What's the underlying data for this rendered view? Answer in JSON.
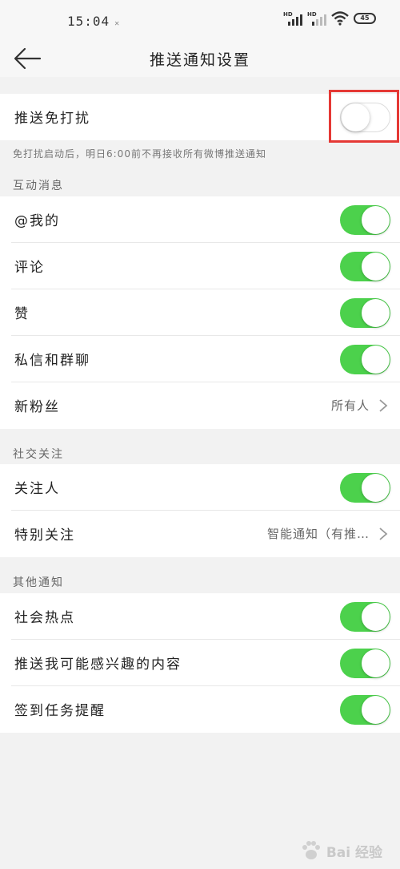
{
  "status_bar": {
    "time": "15:04",
    "mute_mark": "✕",
    "sim1_label": "HD",
    "sim2_label": "HD",
    "battery": "45",
    "icons": [
      "signal-icon",
      "signal-icon",
      "wifi-icon",
      "battery-icon"
    ]
  },
  "header": {
    "title": "推送通知设置",
    "back_icon": "back-arrow-icon"
  },
  "dnd": {
    "label": "推送免打扰",
    "enabled": false,
    "hint": "免打扰启动后，明日6:00前不再接收所有微博推送通知"
  },
  "sections": [
    {
      "title": "互动消息",
      "items": [
        {
          "label": "@我的",
          "type": "toggle",
          "enabled": true
        },
        {
          "label": "评论",
          "type": "toggle",
          "enabled": true
        },
        {
          "label": "赞",
          "type": "toggle",
          "enabled": true
        },
        {
          "label": "私信和群聊",
          "type": "toggle",
          "enabled": true
        },
        {
          "label": "新粉丝",
          "type": "select",
          "value": "所有人"
        }
      ]
    },
    {
      "title": "社交关注",
      "items": [
        {
          "label": "关注人",
          "type": "toggle",
          "enabled": true
        },
        {
          "label": "特别关注",
          "type": "select",
          "value": "智能通知（有推…"
        }
      ]
    },
    {
      "title": "其他通知",
      "items": [
        {
          "label": "社会热点",
          "type": "toggle",
          "enabled": true
        },
        {
          "label": "推送我可能感兴趣的内容",
          "type": "toggle",
          "enabled": true
        },
        {
          "label": "签到任务提醒",
          "type": "toggle",
          "enabled": true
        }
      ]
    }
  ],
  "colors": {
    "toggle_on": "#4cd14c",
    "highlight_box": "#e53935",
    "background": "#f2f2f2"
  },
  "watermark": {
    "text": "Bai 经验",
    "icon": "paw-icon"
  }
}
